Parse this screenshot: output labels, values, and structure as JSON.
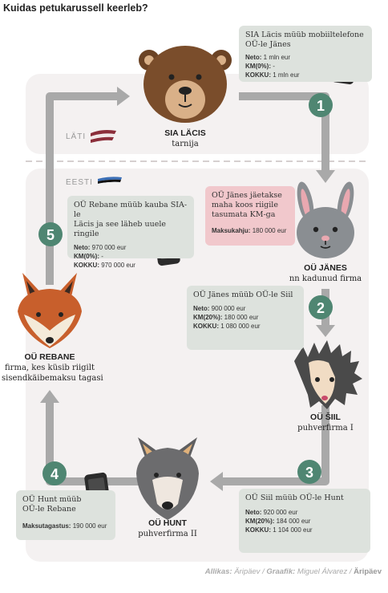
{
  "title": "Kuidas petukarussell keerleb?",
  "regions": {
    "top": "LÄTI",
    "bottom": "EESTI"
  },
  "colors": {
    "arrow": "#a9a9a9",
    "step_circle": "#4f8672",
    "box": "#dde2dd",
    "warning_box": "#f1c8cc",
    "region_bg": "#f4f1f1"
  },
  "nodes": [
    {
      "name": "SIA LÄCIS",
      "role": "tarnija",
      "icon": "bear-icon"
    },
    {
      "name": "OÜ JÄNES",
      "role": "nn kadunud firma",
      "icon": "rabbit-icon"
    },
    {
      "name": "OÜ ŠIIL",
      "role": "puhverfirma I",
      "icon": "hedgehog-icon"
    },
    {
      "name": "OÜ HUNT",
      "role": "puhverfirma II",
      "icon": "wolf-icon"
    },
    {
      "name": "OÜ REBANE",
      "role_line1": "firma, kes küsib riigilt",
      "role_line2": "sisendkäibemaksu tagasi",
      "icon": "fox-icon"
    }
  ],
  "steps": [
    "1",
    "2",
    "3",
    "4",
    "5"
  ],
  "boxes": {
    "step1": {
      "head_line1": "SIA Läcis müüb mobiiltelefone",
      "head_line2": "OÜ-le Jänes",
      "rows": [
        {
          "label": "Neto:",
          "value": " 1 mln eur"
        },
        {
          "label": "KM(0%):",
          "value": " -"
        },
        {
          "label": "KOKKU:",
          "value": " 1 mln eur"
        }
      ]
    },
    "warning": {
      "head_line1": "OÜ Jänes jäetakse",
      "head_line2": "maha koos riigile",
      "head_line3": "tasumata KM-ga",
      "rows": [
        {
          "label": "Maksukahju:",
          "value": " 180 000 eur"
        }
      ]
    },
    "step2": {
      "head_line1": "OÜ Jänes müüb OÜ-le Siil",
      "rows": [
        {
          "label": "Neto:",
          "value": " 900 000 eur"
        },
        {
          "label": "KM(20%):",
          "value": " 180 000 eur"
        },
        {
          "label": "KOKKU:",
          "value": " 1 080 000 eur"
        }
      ]
    },
    "step3": {
      "head_line1": "OÜ Siil müüb OÜ-le Hunt",
      "rows": [
        {
          "label": "Neto:",
          "value": " 920 000 eur"
        },
        {
          "label": "KM(20%):",
          "value": " 184 000 eur"
        },
        {
          "label": "KOKKU:",
          "value": " 1 104 000 eur"
        }
      ]
    },
    "step4": {
      "head_line1": "OÜ Hunt müüb",
      "head_line2": "OÜ-le Rebane",
      "rows": [
        {
          "label": "Maksutagastus:",
          "value": " 190 000 eur"
        }
      ]
    },
    "step5": {
      "head_line1": "OÜ Rebane müüb kauba SIA-le",
      "head_line2": "Läcis ja see läheb uuele ringile",
      "rows": [
        {
          "label": "Neto:",
          "value": " 970 000 eur"
        },
        {
          "label": "KM(0%):",
          "value": " -"
        },
        {
          "label": "KOKKU:",
          "value": " 970 000 eur"
        }
      ]
    }
  },
  "footer": {
    "source_label": "Allikas:",
    "source": " Äripäev",
    "graphic_label": "Graafik:",
    "graphic": " Miguel Álvarez",
    "brand": "Äripäev"
  }
}
